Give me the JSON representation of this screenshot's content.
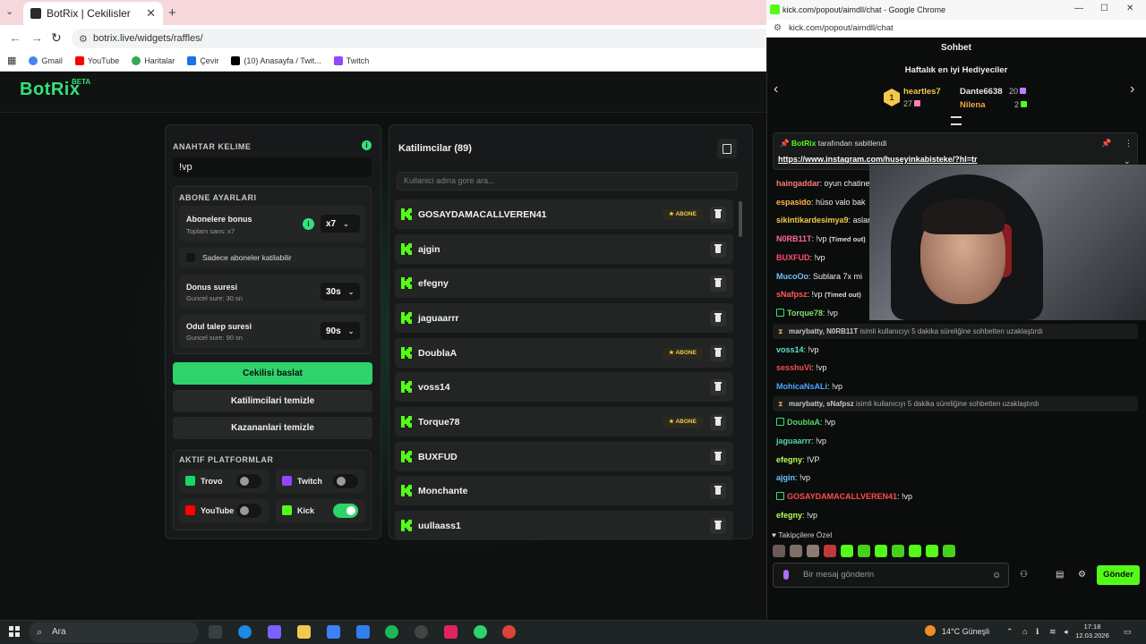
{
  "browser": {
    "tab_title": "BotRix | Cekilisler",
    "new_tab": "+",
    "url": "botrix.live/widgets/raffles/",
    "bookmarks": [
      "Gmail",
      "YouTube",
      "Haritalar",
      "Çevir",
      "(10) Anasayfa / Twit...",
      "Twitch"
    ]
  },
  "app": {
    "logo": "BotRix",
    "beta": "BETA"
  },
  "settings": {
    "keyword_title": "ANAHTAR KELIME",
    "keyword_value": "!vp",
    "sub_title": "ABONE AYARLARI",
    "sub_bonus_label": "Abonelere bonus",
    "sub_bonus_sub": "Toplam sans: x7",
    "sub_bonus_value": "x7",
    "only_subs_label": "Sadece aboneler katilabilir",
    "duration_label": "Donus suresi",
    "duration_sub": "Guncel sure: 30 sn",
    "duration_value": "30s",
    "claim_label": "Odul talep suresi",
    "claim_sub": "Guncel sure: 90 sn",
    "claim_value": "90s",
    "start_button": "Cekilisi baslat",
    "clear_participants": "Katilimcilari temizle",
    "clear_winners": "Kazananlari temizle",
    "platforms_title": "AKTIF PLATFORMLAR",
    "platforms": [
      {
        "name": "Trovo",
        "enabled": false,
        "color": "#19d66b"
      },
      {
        "name": "Twitch",
        "enabled": false,
        "color": "#9146ff"
      },
      {
        "name": "YouTube",
        "enabled": false,
        "color": "#ff0000"
      },
      {
        "name": "Kick",
        "enabled": true,
        "color": "#53fc18"
      }
    ]
  },
  "participants": {
    "title": "Katilimcilar (89)",
    "search_placeholder": "Kullanici adina gore ara...",
    "badge_label": "ABONE",
    "list": [
      {
        "name": "GOSAYDAMACALLVEREN41",
        "sub": true
      },
      {
        "name": "ajgin",
        "sub": false
      },
      {
        "name": "efegny",
        "sub": false
      },
      {
        "name": "jaguaarrr",
        "sub": false
      },
      {
        "name": "DoublaA",
        "sub": true
      },
      {
        "name": "voss14",
        "sub": false
      },
      {
        "name": "Torque78",
        "sub": true
      },
      {
        "name": "BUXFUD",
        "sub": false
      },
      {
        "name": "Monchante",
        "sub": false
      },
      {
        "name": "uullaass1",
        "sub": false
      }
    ]
  },
  "chat_window": {
    "title": "kick.com/popout/aimdll/chat - Google Chrome",
    "url": "kick.com/popout/aimdll/chat",
    "header": "Sohbet",
    "gifters_title": "Haftalık en iyi Hediyeciler",
    "gifters": [
      {
        "rank": "1",
        "name": "heartles7",
        "value": "27"
      },
      {
        "name": "Dante6638",
        "value": "20"
      },
      {
        "name": "Nilena",
        "value": "2"
      }
    ],
    "pinned_by": "BotRix",
    "pinned_suffix": "tarafından sabitlendi",
    "pinned_link": "https://www.instagram.com/huseyinkabisteke/?hl=tr",
    "messages": [
      {
        "user": "haingaddar",
        "text": ": oyun chatine",
        "color": "#ff7a7a"
      },
      {
        "user": "espasido",
        "text": ": hüso valo bak",
        "color": "#ffb347"
      },
      {
        "user": "sikintikardesimya9",
        "text": ": aslan",
        "color": "#f2c94c"
      },
      {
        "user": "N0RB11T",
        "text": ": !vp",
        "timeout": "(Timed out)",
        "color": "#ff6b9a"
      },
      {
        "user": "BUXFUD",
        "text": ": !vp",
        "color": "#ff4d6d"
      },
      {
        "user": "MucoOo",
        "text": ": Sublara 7x mi",
        "color": "#6ec1ff"
      },
      {
        "user": "sNafpsz",
        "text": ": !vp",
        "timeout": "(Timed out)",
        "color": "#ff5a5a"
      },
      {
        "user": "Torque78",
        "text": ": !vp",
        "color": "#7ee36b"
      },
      {
        "user": "voss14",
        "text": ": !vp",
        "color": "#5ee0c8"
      },
      {
        "user": "sesshuVi",
        "text": ": !vp",
        "color": "#ff4d4d"
      },
      {
        "user": "MohicaNsALi",
        "text": ": !vp",
        "color": "#4da6ff"
      },
      {
        "user": "DoublaA",
        "text": ": !vp",
        "color": "#53d86a"
      },
      {
        "user": "jaguaarrr",
        "text": ": !vp",
        "color": "#53d8a0"
      },
      {
        "user": "efegny",
        "text": ": !VP",
        "color": "#b6ff5e"
      },
      {
        "user": "ajgin",
        "text": ": !vp",
        "color": "#6ec1ff"
      },
      {
        "user": "GOSAYDAMACALLVEREN41",
        "text": ": !vp",
        "color": "#ff4d4d"
      },
      {
        "user": "efegny",
        "text": ": !vp",
        "color": "#b6ff5e"
      }
    ],
    "system_messages": [
      {
        "actors": "marybatty, N0RB11T",
        "text": "isimli kullanıcıyı 5 dakika süreliğine sohbetten uzaklaştırdı"
      },
      {
        "actors": "marybatty, sNafpsz",
        "text": "isimli kullanıcıyı 5 dakika süreliğine sohbetten uzaklaştırdı"
      }
    ],
    "followers_label": "Takipçilere Özel",
    "input_placeholder": "Bir mesaj gönderin",
    "send_button": "Gönder"
  },
  "taskbar": {
    "search": "Ara",
    "weather": "14°C  Güneşli",
    "time": "17:18",
    "date": "12.03.2026"
  }
}
